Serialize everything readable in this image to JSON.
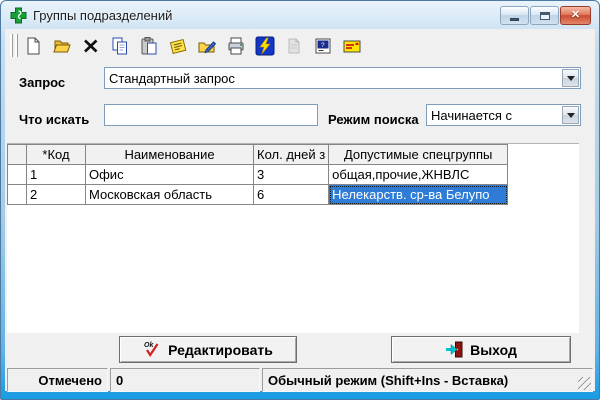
{
  "window": {
    "title": "Группы подразделений",
    "app_icon": "pharmacy-cross-icon"
  },
  "titlebar_buttons": [
    "minimize",
    "maximize",
    "close"
  ],
  "toolbar": {
    "icons": [
      {
        "name": "new-document-icon",
        "enabled": true
      },
      {
        "name": "open-folder-icon",
        "enabled": true
      },
      {
        "name": "delete-x-icon",
        "enabled": true
      },
      {
        "name": "copy-icon",
        "enabled": true
      },
      {
        "name": "paste-icon",
        "enabled": true
      },
      {
        "name": "edit-note-icon",
        "enabled": true
      },
      {
        "name": "sign-document-icon",
        "enabled": true
      },
      {
        "name": "print-icon",
        "enabled": true
      },
      {
        "name": "execute-lightning-icon",
        "enabled": true
      },
      {
        "name": "print-secondary-icon",
        "enabled": false
      },
      {
        "name": "report-icon",
        "enabled": true
      },
      {
        "name": "mail-icon",
        "enabled": true
      }
    ]
  },
  "form": {
    "query_label": "Запрос",
    "query_value": "Стандартный запрос",
    "search_label": "Что искать",
    "search_value": "",
    "mode_label": "Режим поиска",
    "mode_value": "Начинается с"
  },
  "table": {
    "columns": [
      "",
      "*Код",
      "Наименование",
      "Кол. дней з",
      "Допустимые спецгруппы"
    ],
    "rows": [
      {
        "code": "1",
        "name": "Офис",
        "days": "3",
        "groups": "общая,прочие,ЖНВЛС",
        "selected": false
      },
      {
        "code": "2",
        "name": "Московская область",
        "days": "6",
        "groups": "Нелекарств. ср-ва Белупо",
        "selected": true
      }
    ]
  },
  "buttons": {
    "edit_label": "Редактировать",
    "edit_icon": "ok-checkmark-icon",
    "exit_label": "Выход",
    "exit_icon": "exit-door-icon"
  },
  "status": {
    "marked_label": "Отмечено",
    "marked_value": "0",
    "mode_text": "Обычный режим (Shift+Ins - Вставка)"
  },
  "colors": {
    "selection": "#2E7CD6",
    "frame_bottom": "#189BE4",
    "client_bg": "#F0F0F0"
  }
}
